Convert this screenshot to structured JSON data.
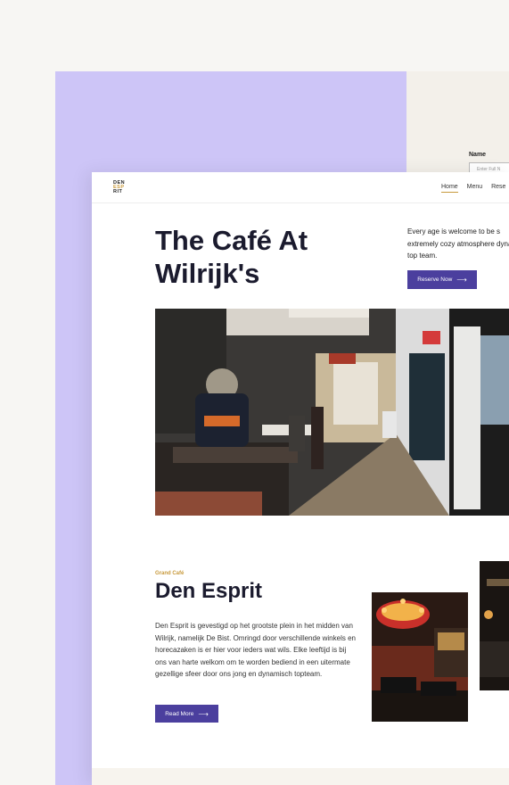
{
  "back_form": {
    "name_label": "Name",
    "name_placeholder": "Enter Full N"
  },
  "logo": {
    "line1": "DEN",
    "line2": "ESP",
    "line3": "RIT"
  },
  "nav": {
    "items": [
      "Home",
      "Menu",
      "Rese"
    ]
  },
  "hero": {
    "title_line1": "The Café At",
    "title_line2": "Wilrijk's",
    "text": "Every age is welcome to be s extremely cozy atmosphere dynamic top team.",
    "button_label": "Reserve Now"
  },
  "section": {
    "eyebrow": "Grand Café",
    "title": "Den Esprit",
    "paragraph": "Den Esprit is gevestigd op het grootste plein in het midden van Wilrijk, namelijk De Bist. Omringd door verschillende winkels en horecazaken is er hier voor ieders wat wils. Elke leeftijd is bij ons van harte welkom om te worden bediend in een uitermate gezellige sfeer door ons jong en dynamisch topteam.",
    "button_label": "Read More"
  },
  "colors": {
    "lavender": "#cdc5f7",
    "accent": "#4b3f9e",
    "gold": "#c89a3d",
    "heading": "#1b1b2e"
  },
  "icons": {
    "arrow": "arrow-right-icon"
  }
}
